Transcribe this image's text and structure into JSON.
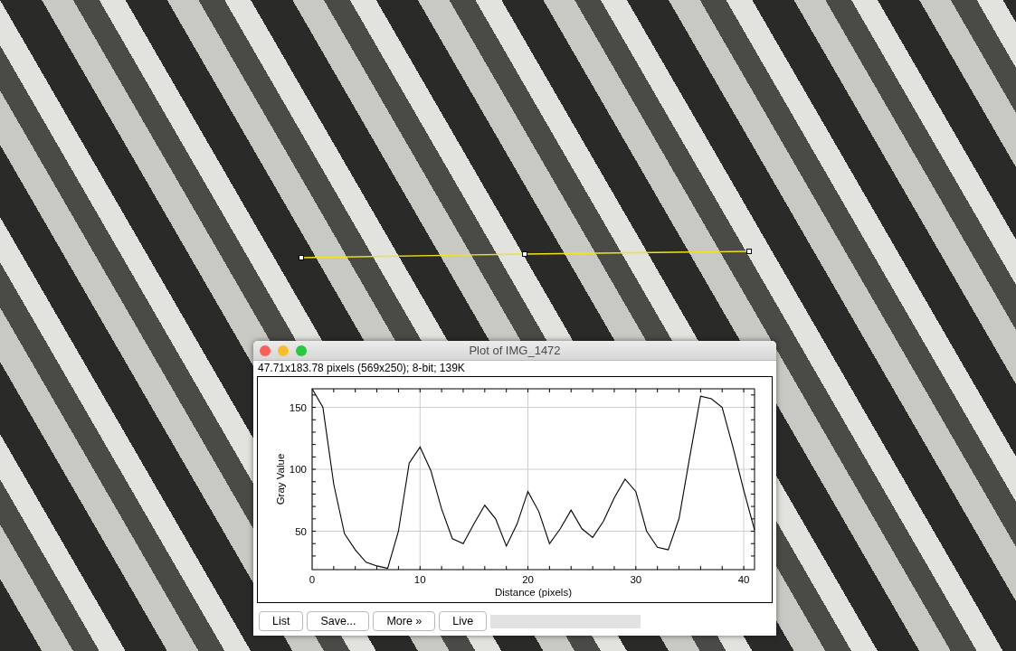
{
  "window": {
    "title": "Plot of IMG_1472"
  },
  "info": "47.71x183.78 pixels (569x250); 8-bit; 139K",
  "chart": {
    "chart_data": {
      "type": "line",
      "xlabel": "Distance (pixels)",
      "ylabel": "Gray Value",
      "xlim": [
        0,
        41
      ],
      "ylim": [
        19,
        165
      ],
      "xticks": [
        0,
        10,
        20,
        30,
        40
      ],
      "yticks": [
        50,
        100,
        150
      ],
      "x": [
        0,
        1,
        2,
        3,
        4,
        5,
        6,
        7,
        8,
        9,
        10,
        11,
        12,
        13,
        14,
        15,
        16,
        17,
        18,
        19,
        20,
        21,
        22,
        23,
        24,
        25,
        26,
        27,
        28,
        29,
        30,
        31,
        32,
        33,
        34,
        35,
        36,
        37,
        38,
        39,
        40,
        41
      ],
      "grid": true,
      "series": [
        {
          "color": "#000000",
          "values": [
            165,
            150,
            88,
            48,
            35,
            25,
            22,
            20,
            50,
            105,
            118,
            99,
            68,
            44,
            40,
            56,
            71,
            60,
            38,
            56,
            82,
            66,
            40,
            52,
            67,
            52,
            45,
            58,
            77,
            92,
            82,
            50,
            37,
            35,
            60,
            110,
            159,
            157,
            150,
            118,
            83,
            51
          ]
        }
      ]
    }
  },
  "buttons": [
    "List",
    "Save...",
    "More »",
    "Live"
  ]
}
